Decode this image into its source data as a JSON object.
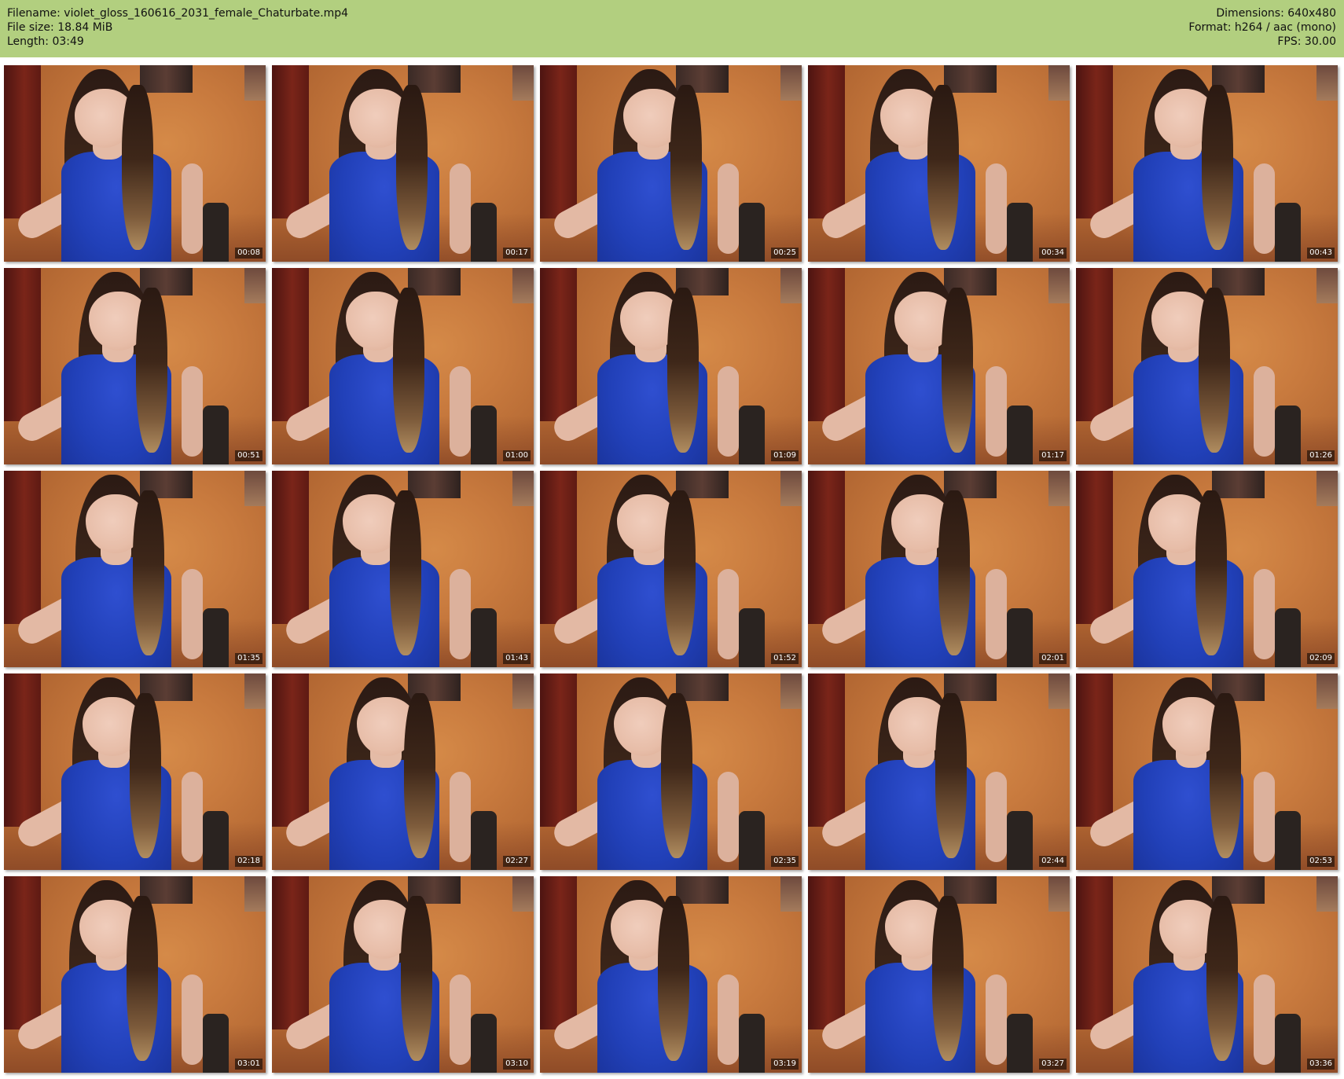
{
  "header": {
    "left": [
      "Filename: violet_gloss_160616_2031_female_Chaturbate.mp4",
      "File size: 18.84 MiB",
      "Length: 03:49"
    ],
    "right": [
      "Dimensions: 640x480",
      "Format: h264 / aac (mono)",
      "FPS: 30.00"
    ]
  },
  "thumbnails": [
    {
      "timestamp": "00:08"
    },
    {
      "timestamp": "00:17"
    },
    {
      "timestamp": "00:25"
    },
    {
      "timestamp": "00:34"
    },
    {
      "timestamp": "00:43"
    },
    {
      "timestamp": "00:51"
    },
    {
      "timestamp": "01:00"
    },
    {
      "timestamp": "01:09"
    },
    {
      "timestamp": "01:17"
    },
    {
      "timestamp": "01:26"
    },
    {
      "timestamp": "01:35"
    },
    {
      "timestamp": "01:43"
    },
    {
      "timestamp": "01:52"
    },
    {
      "timestamp": "02:01"
    },
    {
      "timestamp": "02:09"
    },
    {
      "timestamp": "02:18"
    },
    {
      "timestamp": "02:27"
    },
    {
      "timestamp": "02:35"
    },
    {
      "timestamp": "02:44"
    },
    {
      "timestamp": "02:53"
    },
    {
      "timestamp": "03:01"
    },
    {
      "timestamp": "03:10"
    },
    {
      "timestamp": "03:19"
    },
    {
      "timestamp": "03:27"
    },
    {
      "timestamp": "03:36"
    }
  ],
  "colors": {
    "header_bg": "#b2cf7f",
    "page_bg": "#ffffff",
    "timestamp_bg": "#000000",
    "timestamp_text": "#ffffff"
  }
}
